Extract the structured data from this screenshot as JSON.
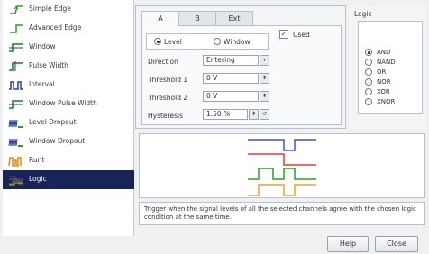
{
  "trigger_list": {
    "items": [
      {
        "label": "Simple Edge",
        "icon": "simple-edge-icon"
      },
      {
        "label": "Advanced Edge",
        "icon": "advanced-edge-icon"
      },
      {
        "label": "Window",
        "icon": "window-icon"
      },
      {
        "label": "Pulse Width",
        "icon": "pulse-width-icon"
      },
      {
        "label": "Interval",
        "icon": "interval-icon"
      },
      {
        "label": "Window Pulse Width",
        "icon": "window-pulse-width-icon"
      },
      {
        "label": "Level Dropout",
        "icon": "level-dropout-icon"
      },
      {
        "label": "Window Dropout",
        "icon": "window-dropout-icon"
      },
      {
        "label": "Runt",
        "icon": "runt-icon"
      },
      {
        "label": "Logic",
        "icon": "logic-icon"
      }
    ],
    "selected": "Logic"
  },
  "tabs": [
    {
      "label": "A",
      "active": true
    },
    {
      "label": "B",
      "active": false
    },
    {
      "label": "Ext",
      "active": false
    }
  ],
  "used": {
    "label": "Used",
    "checked": true
  },
  "mode": {
    "level_label": "Level",
    "window_label": "Window",
    "selected": "Level"
  },
  "fields": {
    "direction": {
      "label": "Direction",
      "value": "Entering"
    },
    "threshold1": {
      "label": "Threshold 1",
      "value": "0 V"
    },
    "threshold2": {
      "label": "Threshold 2",
      "value": "0 V"
    },
    "hysteresis": {
      "label": "Hysteresis",
      "value": "1.50 %"
    }
  },
  "logic": {
    "title": "Logic",
    "options": [
      "AND",
      "NAND",
      "OR",
      "NOR",
      "XOR",
      "XNOR"
    ],
    "selected": "AND"
  },
  "description": "Trigger when the signal levels of all the selected channels agree with the chosen logic condition at the same time.",
  "buttons": {
    "help": "Help",
    "close": "Close"
  },
  "colors": {
    "selected_bg": "#16245a",
    "wave_blue": "#4a4ad8",
    "wave_red": "#e03a3a",
    "wave_green": "#2e9a2e",
    "wave_orange": "#f0a020",
    "icon_green": "#2e9a2e",
    "icon_blue": "#2a3a9a"
  }
}
